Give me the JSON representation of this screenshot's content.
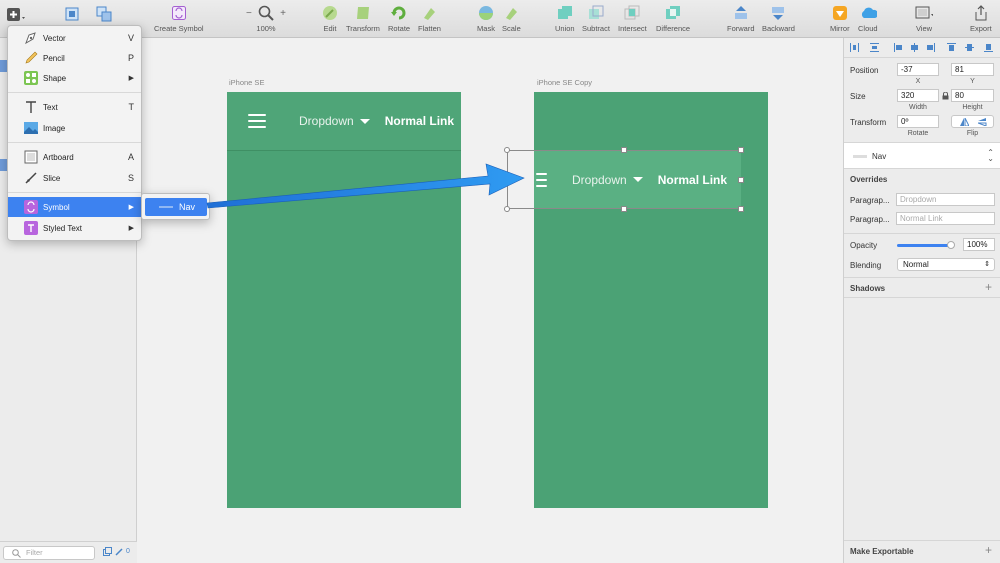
{
  "toolbar": {
    "items": [
      {
        "label": "Create Symbol",
        "icon": "create-symbol-icon"
      },
      {
        "label": "100%",
        "icon": "zoom-icon"
      },
      {
        "label": "Edit",
        "icon": "edit-icon"
      },
      {
        "label": "Transform",
        "icon": "transform-icon"
      },
      {
        "label": "Rotate",
        "icon": "rotate-icon"
      },
      {
        "label": "Flatten",
        "icon": "flatten-icon"
      },
      {
        "label": "Mask",
        "icon": "mask-icon"
      },
      {
        "label": "Scale",
        "icon": "scale-icon"
      },
      {
        "label": "Union",
        "icon": "union-icon"
      },
      {
        "label": "Subtract",
        "icon": "subtract-icon"
      },
      {
        "label": "Intersect",
        "icon": "intersect-icon"
      },
      {
        "label": "Difference",
        "icon": "difference-icon"
      },
      {
        "label": "Forward",
        "icon": "forward-icon"
      },
      {
        "label": "Backward",
        "icon": "backward-icon"
      },
      {
        "label": "Mirror",
        "icon": "mirror-icon"
      },
      {
        "label": "Cloud",
        "icon": "cloud-icon"
      },
      {
        "label": "View",
        "icon": "view-icon"
      },
      {
        "label": "Export",
        "icon": "export-icon"
      }
    ]
  },
  "insert_menu": {
    "items": [
      {
        "label": "Vector",
        "shortcut": "V",
        "icon": "vector-pen-icon"
      },
      {
        "label": "Pencil",
        "shortcut": "P",
        "icon": "pencil-icon"
      },
      {
        "label": "Shape",
        "shortcut": "▶",
        "icon": "shape-icon"
      },
      {
        "label": "Text",
        "shortcut": "T",
        "icon": "text-icon"
      },
      {
        "label": "Image",
        "shortcut": "",
        "icon": "image-icon"
      },
      {
        "label": "Artboard",
        "shortcut": "A",
        "icon": "artboard-icon"
      },
      {
        "label": "Slice",
        "shortcut": "S",
        "icon": "slice-icon"
      },
      {
        "label": "Symbol",
        "shortcut": "▶",
        "icon": "symbol-icon",
        "active": true
      },
      {
        "label": "Styled Text",
        "shortcut": "▶",
        "icon": "styled-text-icon"
      }
    ],
    "submenu": {
      "label": "Nav"
    }
  },
  "canvas": {
    "artboard1": {
      "title": "iPhone SE",
      "nav": {
        "dropdown": "Dropdown",
        "link": "Normal Link"
      }
    },
    "artboard2": {
      "title": "iPhone SE Copy",
      "nav": {
        "dropdown": "Dropdown",
        "link": "Normal Link"
      }
    }
  },
  "left_panel": {
    "filter_placeholder": "Filter",
    "filter_count": "0"
  },
  "inspector": {
    "position": {
      "label": "Position",
      "x": "-37",
      "y": "81",
      "x_label": "X",
      "y_label": "Y"
    },
    "size": {
      "label": "Size",
      "width": "320",
      "height": "80",
      "w_label": "Width",
      "h_label": "Height"
    },
    "transform": {
      "label": "Transform",
      "rotate": "0º",
      "rotate_label": "Rotate",
      "flip_label": "Flip"
    },
    "symbol": {
      "name": "Nav"
    },
    "overrides": {
      "title": "Overrides",
      "rows": [
        {
          "label": "Paragrap...",
          "placeholder": "Dropdown"
        },
        {
          "label": "Paragrap...",
          "placeholder": "Normal Link"
        }
      ]
    },
    "opacity": {
      "label": "Opacity",
      "value": "100%",
      "level": 1.0
    },
    "blending": {
      "label": "Blending",
      "value": "Normal"
    },
    "shadows": {
      "title": "Shadows"
    },
    "exportable": {
      "title": "Make Exportable"
    }
  },
  "colors": {
    "artboard_green": "#4ba275",
    "nav_green": "#5ab083",
    "menu_active": "#3d82f0",
    "arrow_blue": "#1e88e5"
  }
}
